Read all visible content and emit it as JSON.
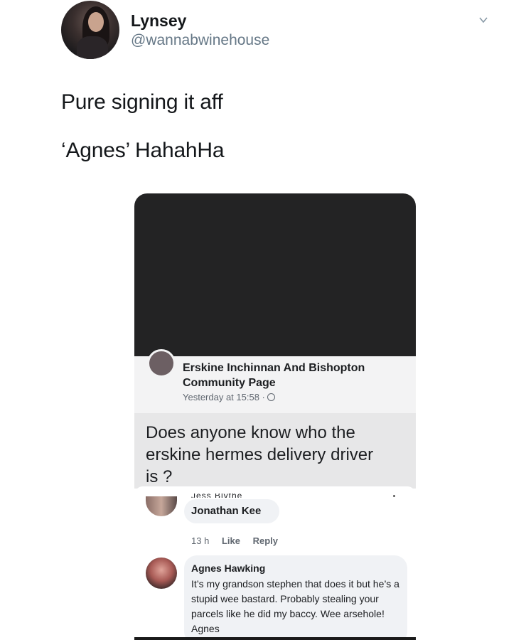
{
  "tweet": {
    "author_name": "Lynsey",
    "author_handle": "@wannabwinehouse",
    "lines": [
      "Pure signing it aff",
      "‘Agnes’ HahahHa"
    ]
  },
  "screenshot": {
    "page_name": "Erskine Inchinnan And Bishopton Community Page",
    "post_time": "Yesterday at 15:58 ·",
    "post_text": "Does anyone know who the erskine hermes delivery driver is ?",
    "cut_off_name": "Jess Blythe",
    "comments": [
      {
        "author": "Jonathan Kee",
        "time": "13 h",
        "like": "Like",
        "reply": "Reply"
      },
      {
        "author": "Agnes Hawking",
        "text": "It’s my grandson stephen that does it but he’s a stupid wee bastard. Probably stealing your parcels like he did my baccy. Wee arsehole! Agnes"
      }
    ]
  },
  "icons": {
    "chevron": "chevron-down-icon",
    "globe": "globe-icon"
  }
}
